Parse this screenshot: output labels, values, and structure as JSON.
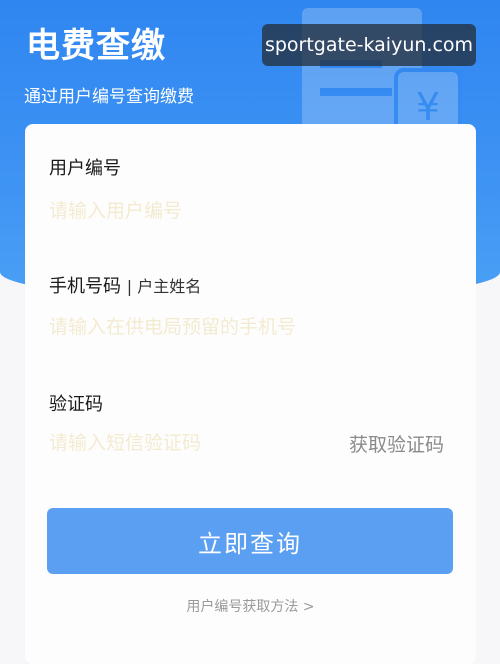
{
  "header": {
    "title": "电费查缴",
    "subtitle": "通过用户编号查询缴费",
    "illustration_icon": "bill-yuan-icon",
    "yuan_symbol": "¥"
  },
  "watermark": {
    "text": "sportgate-kaiyun.com"
  },
  "form": {
    "account_number": {
      "label": "用户编号",
      "placeholder": "请输入用户编号",
      "value": ""
    },
    "phone": {
      "label": "手机号码",
      "label_secondary": "| 户主姓名",
      "placeholder": "请输入在供电局预留的手机号",
      "value": ""
    },
    "verification_code": {
      "label": "验证码",
      "placeholder": "请输入短信验证码",
      "value": "",
      "get_code_label": "获取验证码"
    },
    "submit_label": "立即查询",
    "help_link": "用户编号获取方法 >"
  },
  "colors": {
    "header_blue": "#2f86f0",
    "button_blue": "#5b9ff2",
    "placeholder": "#f3ebd0",
    "page_background": "#f7f6f8"
  }
}
